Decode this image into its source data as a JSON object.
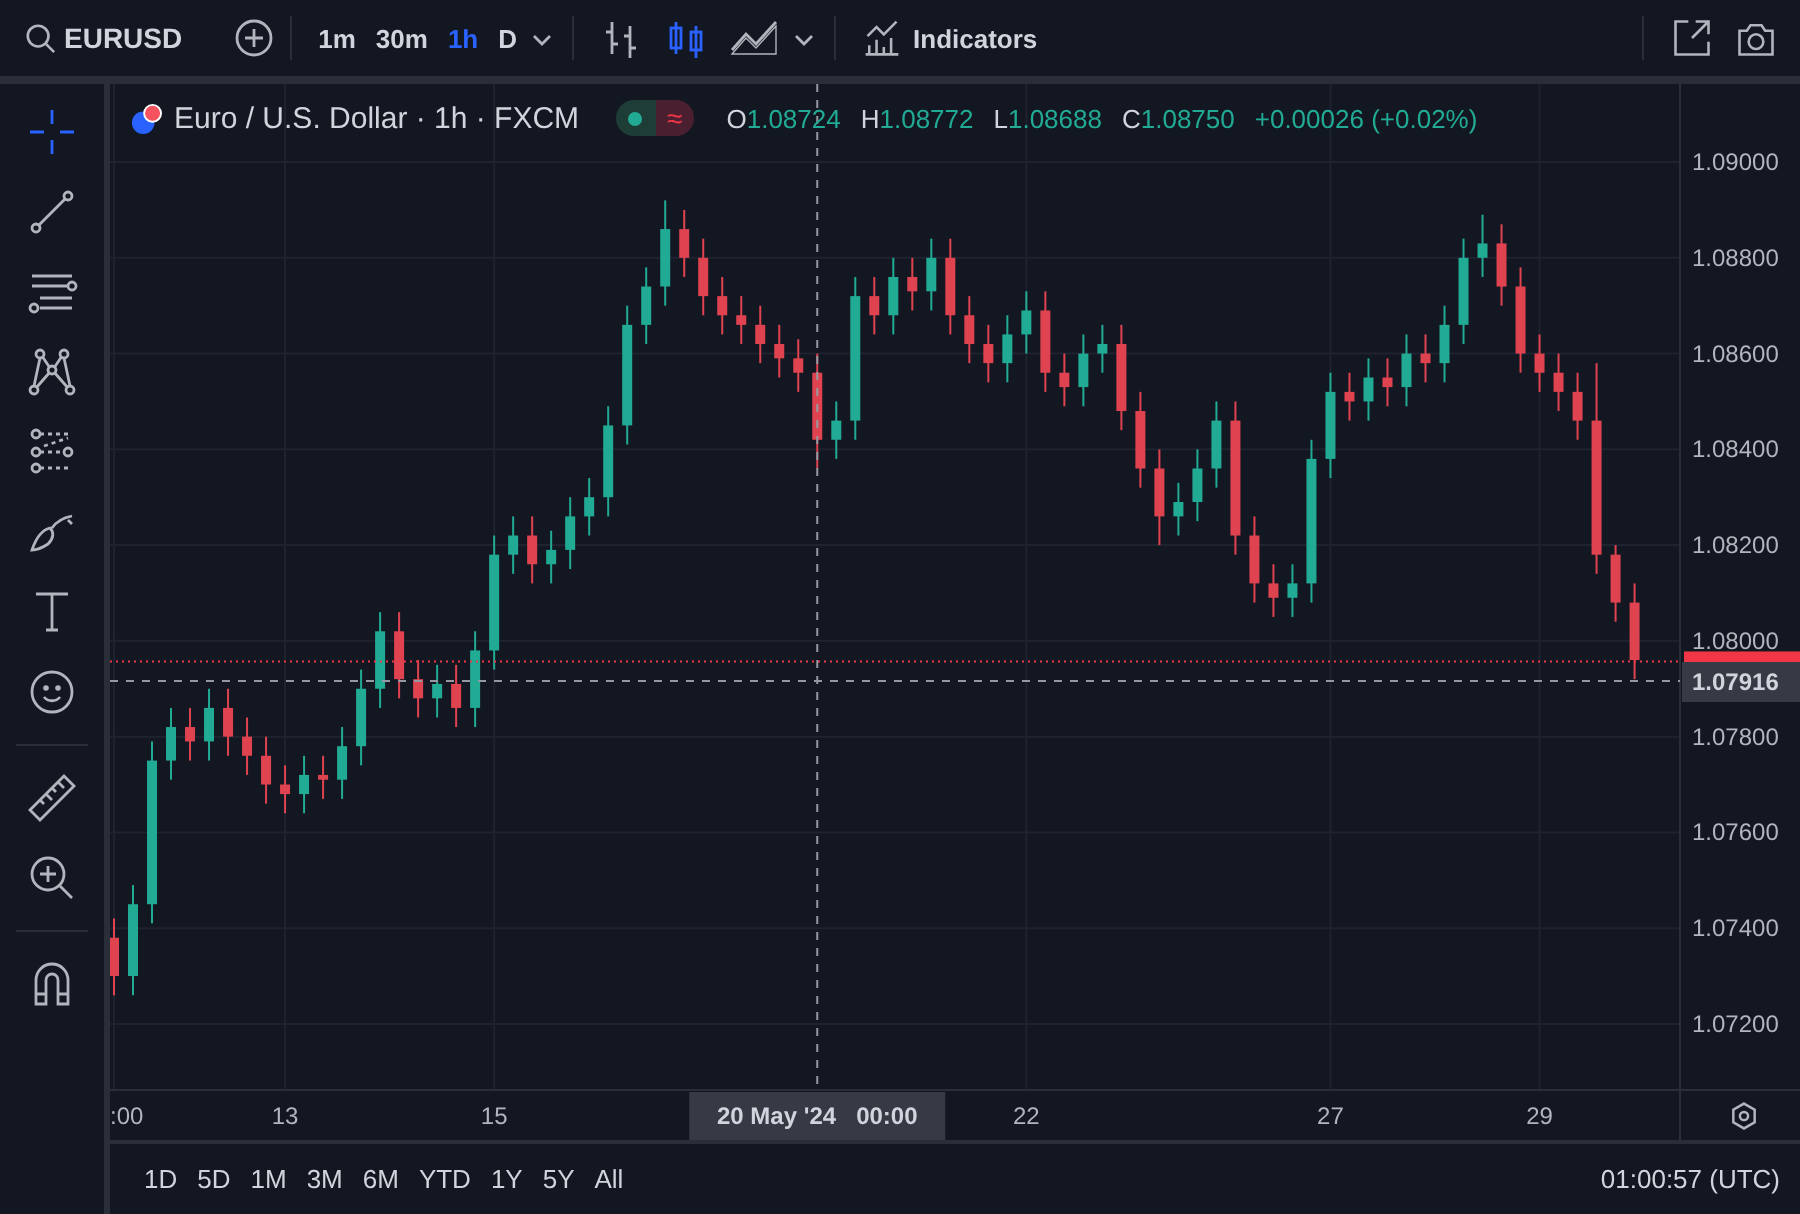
{
  "top_bar": {
    "symbol": "EURUSD",
    "intervals": [
      {
        "label": "1m",
        "selected": false
      },
      {
        "label": "30m",
        "selected": false
      },
      {
        "label": "1h",
        "selected": true
      },
      {
        "label": "D",
        "selected": false
      }
    ],
    "chart_types": [
      {
        "kind": "bars",
        "selected": false
      },
      {
        "kind": "candles",
        "selected": true
      },
      {
        "kind": "area",
        "selected": false
      }
    ],
    "indicators_label": "Indicators"
  },
  "tool_groups": [
    {
      "tools": [
        {
          "kind": "crosshair",
          "selected": true
        },
        {
          "kind": "trend-line",
          "selected": false
        },
        {
          "kind": "parallel-lines",
          "selected": false
        },
        {
          "kind": "pattern",
          "selected": false
        },
        {
          "kind": "forecast",
          "selected": false
        },
        {
          "kind": "brush",
          "selected": false
        },
        {
          "kind": "text",
          "selected": false
        },
        {
          "kind": "emoji",
          "selected": false
        }
      ]
    },
    {
      "tools": [
        {
          "kind": "ruler",
          "selected": false
        },
        {
          "kind": "zoom",
          "selected": false
        }
      ]
    },
    {
      "tools": [
        {
          "kind": "magnet",
          "selected": false
        }
      ]
    }
  ],
  "legend": {
    "title": "Euro / U.S. Dollar · 1h · FXCM",
    "toggle_symbol": "≈",
    "ohlc": [
      {
        "label": "O",
        "value": "1.08724"
      },
      {
        "label": "H",
        "value": "1.08772"
      },
      {
        "label": "L",
        "value": "1.08688"
      },
      {
        "label": "C",
        "value": "1.08750"
      }
    ],
    "change": "+0.00026 (+0.02%)"
  },
  "chart": {
    "chart_data": {
      "type": "candlestick",
      "grid": true,
      "ylim": [
        1.07062,
        1.09163
      ],
      "categories": [
        ":00",
        null,
        null,
        null,
        null,
        null,
        null,
        null,
        null,
        "13",
        null,
        null,
        null,
        null,
        null,
        null,
        null,
        null,
        null,
        null,
        "15",
        null,
        null,
        null,
        null,
        null,
        null,
        null,
        null,
        null,
        null,
        null,
        null,
        null,
        null,
        null,
        null,
        "20 May '24   00:00",
        null,
        null,
        null,
        null,
        null,
        null,
        null,
        null,
        null,
        null,
        "22",
        null,
        null,
        null,
        null,
        null,
        null,
        null,
        null,
        null,
        null,
        null,
        null,
        null,
        null,
        null,
        "27",
        null,
        null,
        null,
        null,
        null,
        null,
        null,
        null,
        null,
        null,
        "29",
        null,
        null,
        null,
        null,
        null
      ],
      "ohlc": [
        [
          1.0738,
          1.0742,
          1.0726,
          1.073
        ],
        [
          1.073,
          1.0749,
          1.0726,
          1.0745
        ],
        [
          1.0745,
          1.0779,
          1.0741,
          1.0775
        ],
        [
          1.0775,
          1.0786,
          1.0771,
          1.0782
        ],
        [
          1.0782,
          1.0786,
          1.0775,
          1.0779
        ],
        [
          1.0779,
          1.079,
          1.0775,
          1.0786
        ],
        [
          1.0786,
          1.079,
          1.0776,
          1.078
        ],
        [
          1.078,
          1.0784,
          1.0772,
          1.0776
        ],
        [
          1.0776,
          1.078,
          1.0766,
          1.077
        ],
        [
          1.077,
          1.0774,
          1.0764,
          1.0768
        ],
        [
          1.0768,
          1.0776,
          1.0764,
          1.0772
        ],
        [
          1.0772,
          1.0776,
          1.0767,
          1.0771
        ],
        [
          1.0771,
          1.0782,
          1.0767,
          1.0778
        ],
        [
          1.0778,
          1.0794,
          1.0774,
          1.079
        ],
        [
          1.079,
          1.0806,
          1.0786,
          1.0802
        ],
        [
          1.0802,
          1.0806,
          1.0788,
          1.0792
        ],
        [
          1.0792,
          1.0796,
          1.0784,
          1.0788
        ],
        [
          1.0788,
          1.0795,
          1.0784,
          1.0791
        ],
        [
          1.0791,
          1.0795,
          1.0782,
          1.0786
        ],
        [
          1.0786,
          1.0802,
          1.0782,
          1.0798
        ],
        [
          1.0798,
          1.0822,
          1.0794,
          1.0818
        ],
        [
          1.0818,
          1.0826,
          1.0814,
          1.0822
        ],
        [
          1.0822,
          1.0826,
          1.0812,
          1.0816
        ],
        [
          1.0816,
          1.0823,
          1.0812,
          1.0819
        ],
        [
          1.0819,
          1.083,
          1.0815,
          1.0826
        ],
        [
          1.0826,
          1.0834,
          1.0822,
          1.083
        ],
        [
          1.083,
          1.0849,
          1.0826,
          1.0845
        ],
        [
          1.0845,
          1.087,
          1.0841,
          1.0866
        ],
        [
          1.0866,
          1.0878,
          1.0862,
          1.0874
        ],
        [
          1.0874,
          1.0892,
          1.087,
          1.0886
        ],
        [
          1.0886,
          1.089,
          1.0876,
          1.088
        ],
        [
          1.088,
          1.0884,
          1.0868,
          1.0872
        ],
        [
          1.0872,
          1.0876,
          1.0864,
          1.0868
        ],
        [
          1.0868,
          1.0872,
          1.0862,
          1.0866
        ],
        [
          1.0866,
          1.087,
          1.0858,
          1.0862
        ],
        [
          1.0862,
          1.0866,
          1.0855,
          1.0859
        ],
        [
          1.0859,
          1.0863,
          1.0852,
          1.0856
        ],
        [
          1.0856,
          1.086,
          1.0836,
          1.0842
        ],
        [
          1.0842,
          1.085,
          1.0838,
          1.0846
        ],
        [
          1.0846,
          1.0876,
          1.0842,
          1.0872
        ],
        [
          1.0872,
          1.0876,
          1.0864,
          1.0868
        ],
        [
          1.0868,
          1.088,
          1.0864,
          1.0876
        ],
        [
          1.0876,
          1.088,
          1.0869,
          1.0873
        ],
        [
          1.0873,
          1.0884,
          1.0869,
          1.088
        ],
        [
          1.088,
          1.0884,
          1.0864,
          1.0868
        ],
        [
          1.0868,
          1.0872,
          1.0858,
          1.0862
        ],
        [
          1.0862,
          1.0866,
          1.0854,
          1.0858
        ],
        [
          1.0858,
          1.0868,
          1.0854,
          1.0864
        ],
        [
          1.0864,
          1.0873,
          1.086,
          1.0869
        ],
        [
          1.0869,
          1.0873,
          1.0852,
          1.0856
        ],
        [
          1.0856,
          1.086,
          1.0849,
          1.0853
        ],
        [
          1.0853,
          1.0864,
          1.0849,
          1.086
        ],
        [
          1.086,
          1.0866,
          1.0856,
          1.0862
        ],
        [
          1.0862,
          1.0866,
          1.0844,
          1.0848
        ],
        [
          1.0848,
          1.0852,
          1.0832,
          1.0836
        ],
        [
          1.0836,
          1.084,
          1.082,
          1.0826
        ],
        [
          1.0826,
          1.0833,
          1.0822,
          1.0829
        ],
        [
          1.0829,
          1.084,
          1.0825,
          1.0836
        ],
        [
          1.0836,
          1.085,
          1.0832,
          1.0846
        ],
        [
          1.0846,
          1.085,
          1.0818,
          1.0822
        ],
        [
          1.0822,
          1.0826,
          1.0808,
          1.0812
        ],
        [
          1.0812,
          1.0816,
          1.0805,
          1.0809
        ],
        [
          1.0809,
          1.0816,
          1.0805,
          1.0812
        ],
        [
          1.0812,
          1.0842,
          1.0808,
          1.0838
        ],
        [
          1.0838,
          1.0856,
          1.0834,
          1.0852
        ],
        [
          1.0852,
          1.0856,
          1.0846,
          1.085
        ],
        [
          1.085,
          1.0859,
          1.0846,
          1.0855
        ],
        [
          1.0855,
          1.0859,
          1.0849,
          1.0853
        ],
        [
          1.0853,
          1.0864,
          1.0849,
          1.086
        ],
        [
          1.086,
          1.0864,
          1.0854,
          1.0858
        ],
        [
          1.0858,
          1.087,
          1.0854,
          1.0866
        ],
        [
          1.0866,
          1.0884,
          1.0862,
          1.088
        ],
        [
          1.088,
          1.0889,
          1.0876,
          1.0883
        ],
        [
          1.0883,
          1.0887,
          1.087,
          1.0874
        ],
        [
          1.0874,
          1.0878,
          1.0856,
          1.086
        ],
        [
          1.086,
          1.0864,
          1.0852,
          1.0856
        ],
        [
          1.0856,
          1.086,
          1.0848,
          1.0852
        ],
        [
          1.0852,
          1.0856,
          1.0842,
          1.0846
        ],
        [
          1.0846,
          1.0858,
          1.0814,
          1.0818
        ],
        [
          1.0818,
          1.082,
          1.0804,
          1.0808
        ],
        [
          1.0808,
          1.0812,
          1.0792,
          1.0796
        ]
      ],
      "yticks": [
        {
          "value": 1.072,
          "label": "1.07200"
        },
        {
          "value": 1.074,
          "label": "1.07400"
        },
        {
          "value": 1.076,
          "label": "1.07600"
        },
        {
          "value": 1.078,
          "label": "1.07800"
        },
        {
          "value": 1.08,
          "label": "1.08000"
        },
        {
          "value": 1.082,
          "label": "1.08200"
        },
        {
          "value": 1.084,
          "label": "1.08400"
        },
        {
          "value": 1.086,
          "label": "1.08600"
        },
        {
          "value": 1.088,
          "label": "1.08800"
        },
        {
          "value": 1.09,
          "label": "1.09000"
        }
      ],
      "ref_lines": [
        {
          "axis": "y",
          "value": 1.07957,
          "color": "#f23645"
        },
        {
          "axis": "y",
          "value": 1.07916,
          "label": "1.07916"
        },
        {
          "axis": "x",
          "value": "20 May '24   00:00"
        }
      ]
    }
  },
  "bottom_bar": {
    "ranges": [
      "1D",
      "5D",
      "1M",
      "3M",
      "6M",
      "YTD",
      "1Y",
      "5Y",
      "All"
    ],
    "clock": "01:00:57 (UTC)"
  }
}
